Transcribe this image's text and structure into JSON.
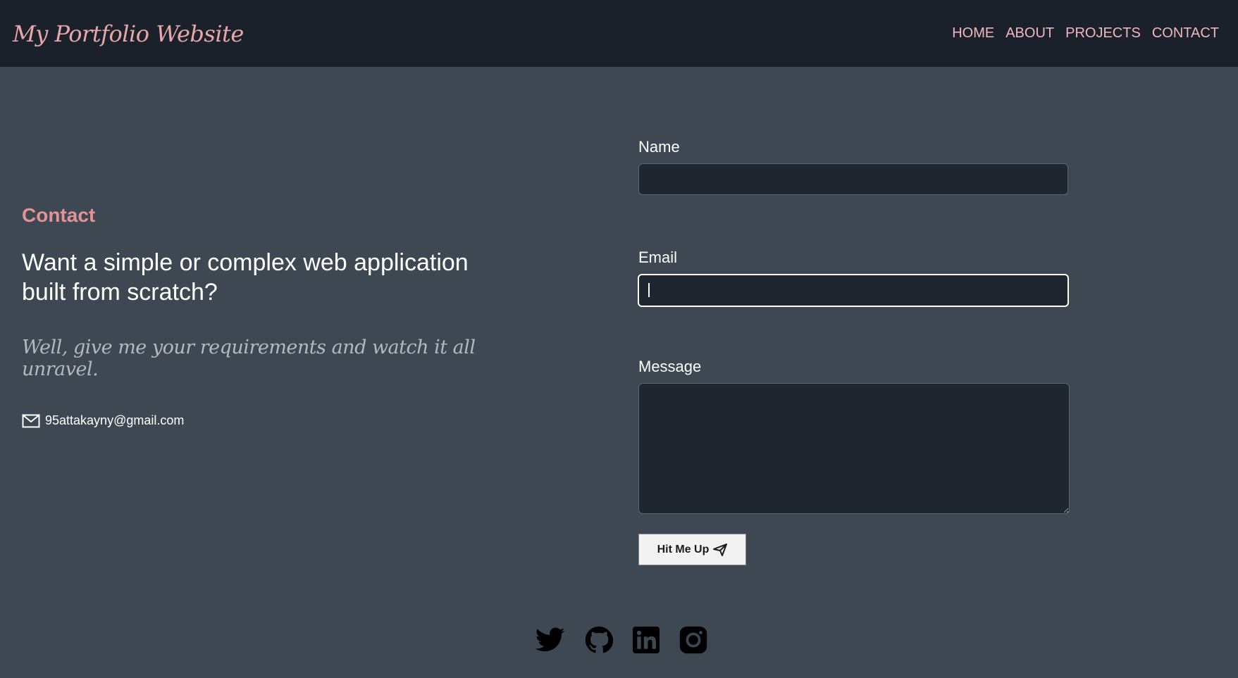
{
  "brand": "My Portfolio Website",
  "nav": [
    "HOME",
    "ABOUT",
    "PROJECTS",
    "CONTACT"
  ],
  "contact": {
    "section_label": "Contact",
    "headline": "Want a simple or complex web application built from scratch?",
    "tagline": "Well, give me your requirements and watch it all unravel.",
    "email": "95attakayny@gmail.com",
    "email_icon": "mail-icon"
  },
  "form": {
    "name_label": "Name",
    "name_value": "",
    "email_label": "Email",
    "email_value": "",
    "message_label": "Message",
    "message_value": "",
    "submit_label": "Hit Me Up",
    "submit_icon": "send-icon"
  },
  "socials": [
    "twitter-icon",
    "github-icon",
    "linkedin-icon",
    "instagram-icon"
  ],
  "colors": {
    "navbar_bg": "#1b212b",
    "page_bg": "#3e4852",
    "accent_pink": "#e39396",
    "input_bg": "#1f2630"
  }
}
